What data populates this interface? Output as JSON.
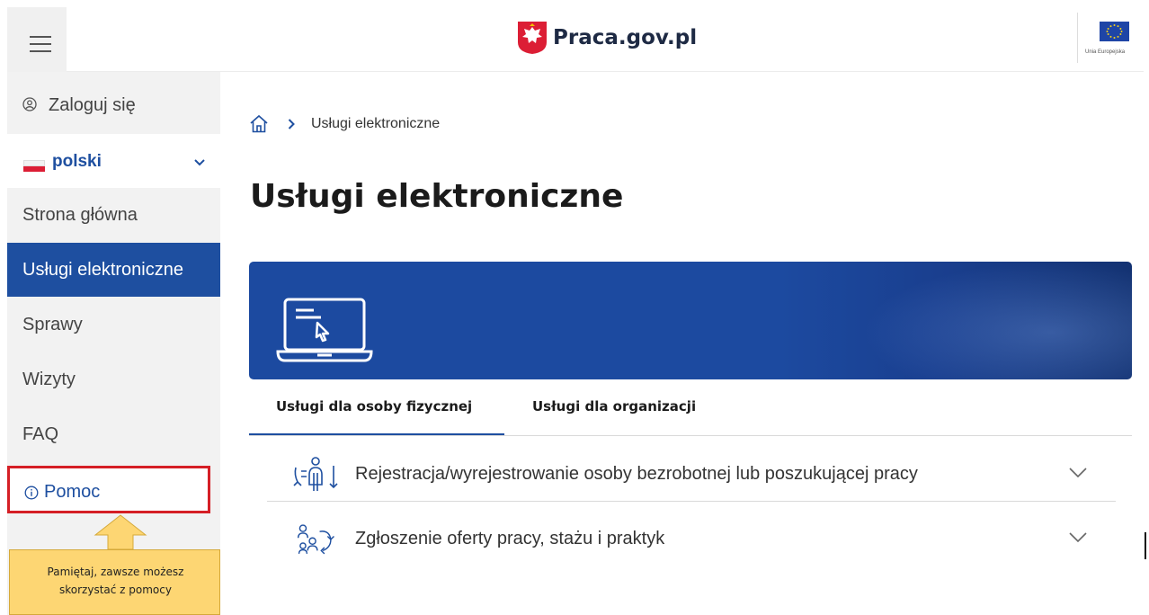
{
  "header": {
    "brand_title": "Praca.gov.pl",
    "eu_label": "Unia Europejska",
    "accent_color": "#1e4fa0"
  },
  "sidebar": {
    "login_label": "Zaloguj się",
    "language_label": "polski",
    "items": [
      {
        "label": "Strona główna",
        "active": false
      },
      {
        "label": "Usługi elektroniczne",
        "active": true
      },
      {
        "label": "Sprawy",
        "active": false
      },
      {
        "label": "Wizyty",
        "active": false
      },
      {
        "label": "FAQ",
        "active": false
      }
    ],
    "help_label": "Pomoc",
    "callout_lines": [
      "Pamiętaj, zawsze możesz",
      "skorzystać z pomocy"
    ]
  },
  "main": {
    "breadcrumb_current": "Usługi elektroniczne",
    "page_title": "Usługi elektroniczne",
    "tabs": [
      {
        "label": "Usługi dla osoby fizycznej",
        "selected": true
      },
      {
        "label": "Usługi dla organizacji",
        "selected": false
      }
    ],
    "accordion": [
      {
        "label": "Rejestracja/wyrejestrowanie osoby bezrobotnej lub poszukującej pracy",
        "icon": "registration-people-icon"
      },
      {
        "label": "Zgłoszenie oferty pracy, stażu i praktyk",
        "icon": "job-offer-people-icon"
      }
    ]
  }
}
